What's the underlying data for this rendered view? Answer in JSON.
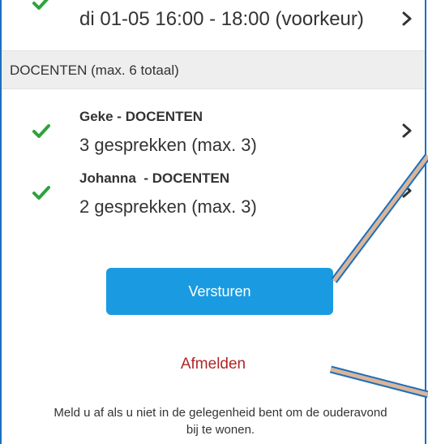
{
  "top_row": {
    "text": "di 01-05 16:00 - 18:00 (voorkeur)"
  },
  "section": {
    "title": "DOCENTEN (max. 6 totaal)"
  },
  "teachers": [
    {
      "name": "Geke - DOCENTEN",
      "count": "3 gesprekken (max. 3)"
    },
    {
      "name": "Johanna  - DOCENTEN",
      "count": "2 gesprekken (max. 3)"
    }
  ],
  "actions": {
    "send_label": "Versturen",
    "logout_label": "Afmelden",
    "logout_help": "Meld u af als u niet in de gelegenheid bent om de ouderavond bij te wonen."
  },
  "colors": {
    "check": "#2ea33a",
    "button": "#1a9be1",
    "logout": "#b0262a",
    "annotation_fill": "#d9b59a",
    "annotation_border": "#1e6fb8"
  },
  "icons": {
    "check": "checkmark-icon",
    "chevron": "chevron-right-icon"
  }
}
